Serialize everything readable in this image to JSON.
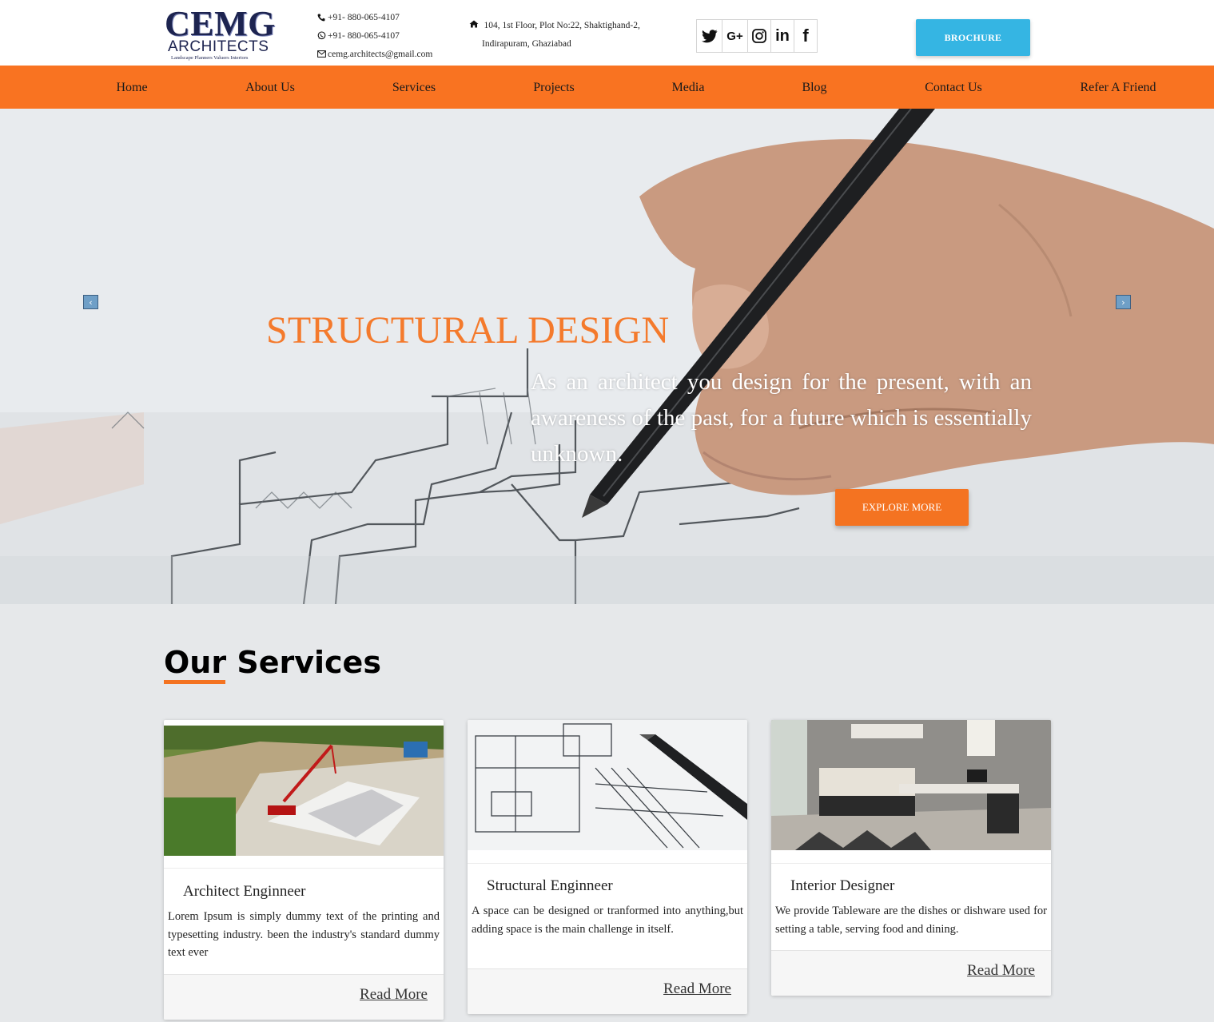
{
  "header": {
    "logo_main": "CEMG",
    "logo_sub": "ARCHITECTS",
    "logo_tagline": "Landscape  Planners  Valuers  Interiors",
    "phone": "+91- 880-065-4107",
    "whatsapp": "+91- 880-065-4107",
    "email": "cemg.architects@gmail.com",
    "address_line1": "104, 1st Floor, Plot No:22, Shaktighand-2,",
    "address_line2": "Indirapuram, Ghaziabad",
    "icons": {
      "phone": "phone-icon",
      "whatsapp": "whatsapp-icon",
      "email": "envelope-icon",
      "address": "home-icon"
    },
    "social": [
      {
        "name": "twitter-icon",
        "glyph": ""
      },
      {
        "name": "google-plus-icon",
        "glyph": "G+"
      },
      {
        "name": "instagram-icon",
        "glyph": ""
      },
      {
        "name": "linkedin-icon",
        "glyph": "in"
      },
      {
        "name": "facebook-icon",
        "glyph": "f"
      }
    ],
    "brochure_label": "BROCHURE"
  },
  "nav": {
    "items": [
      "Home",
      "About Us",
      "Services",
      "Projects",
      "Media",
      "Blog",
      "Contact Us",
      "Refer A Friend"
    ]
  },
  "hero": {
    "title": "STRUCTURAL DESIGN",
    "text": "As an architect you design for the present, with an awareness of the past, for a future which is essentially unknown.",
    "button_label": "EXPLORE MORE",
    "prev_arrow": "‹",
    "next_arrow": "›"
  },
  "services": {
    "heading_part1": "Our",
    "heading_part2": " Services",
    "cards": [
      {
        "title": "Architect Enginneer",
        "text": "Lorem Ipsum is simply dummy text of the printing and typesetting industry. been the industry's standard dummy text ever",
        "link": "Read More"
      },
      {
        "title": "Structural Enginneer",
        "text": "A space can be designed or tranformed into anything,but adding space is the main challenge in itself.",
        "link": "Read More"
      },
      {
        "title": "Interior Designer",
        "text": "We provide Tableware are the dishes or dishware used for setting a table, serving food and dining.",
        "link": "Read More"
      }
    ]
  },
  "colors": {
    "accent_orange": "#f47321",
    "nav_orange": "#f97321",
    "brochure_blue": "#35b5e3",
    "logo_navy": "#1d2450",
    "section_bg": "#e6e8ea"
  }
}
